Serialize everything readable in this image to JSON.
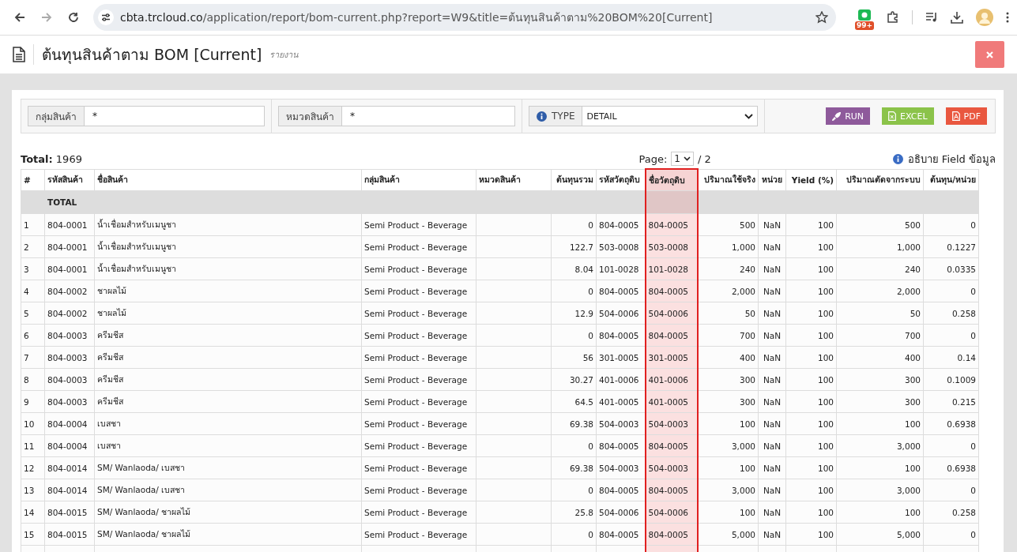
{
  "browser": {
    "url_host": "cbta.trcloud.co",
    "url_path": "/application/report/bom-current.php?report=W9&title=ต้นทุนสินค้าตาม%20BOM%20[Current]",
    "extension_badge": "99+"
  },
  "page_header": {
    "title": "ต้นทุนสินค้าตาม BOM [Current]",
    "subtitle": "รายงาน"
  },
  "filters": [
    {
      "kind": "text",
      "label": "กลุ่มสินค้า",
      "value": "*"
    },
    {
      "kind": "text",
      "label": "หมวดสินค้า",
      "value": "*"
    },
    {
      "kind": "select",
      "label": "TYPE",
      "value": "DETAIL"
    }
  ],
  "actions": [
    {
      "kind": "run",
      "label": "RUN"
    },
    {
      "kind": "excel",
      "label": "EXCEL"
    },
    {
      "kind": "pdf",
      "label": "PDF"
    }
  ],
  "summary": {
    "total": "**Total:** 1969",
    "page_label": "Page:",
    "page": "1",
    "page_count": "/ 2",
    "help_link": "อธิบาย Field ข้อมูล"
  },
  "table": {
    "columns": [
      {
        "label": "#",
        "kind": "text",
        "highlighted": false
      },
      {
        "label": "รหัสสินค้า",
        "kind": "text",
        "highlighted": false
      },
      {
        "label": "ชื่อสินค้า",
        "kind": "text",
        "highlighted": false
      },
      {
        "label": "กลุ่มสินค้า",
        "kind": "text",
        "highlighted": false
      },
      {
        "label": "หมวดสินค้า",
        "kind": "text",
        "highlighted": false
      },
      {
        "label": "ต้นทุนรวม",
        "kind": "number",
        "highlighted": false
      },
      {
        "label": "รหัสวัตถุดิบ",
        "kind": "text",
        "highlighted": false
      },
      {
        "label": "ชื่อวัตถุดิบ",
        "kind": "text",
        "highlighted": true
      },
      {
        "label": "ปริมาณใช้จริง",
        "kind": "number",
        "highlighted": false
      },
      {
        "label": "หน่วย",
        "kind": "unit",
        "highlighted": false
      },
      {
        "label": "Yield (%)",
        "kind": "number",
        "highlighted": false
      },
      {
        "label": "ปริมาณตัดจากระบบ",
        "kind": "number",
        "highlighted": false
      },
      {
        "label": "ต้นทุน/หน่วย",
        "kind": "number",
        "highlighted": false
      }
    ],
    "total_label": "TOTAL",
    "rows": [
      [
        "1",
        "804-0001",
        "น้ำเชื่อมสำหรับเมนูชา",
        "Semi Product - Beverage",
        "",
        "0",
        "804-0005",
        "804-0005",
        "500",
        "NaN",
        "100",
        "500",
        "0"
      ],
      [
        "2",
        "804-0001",
        "น้ำเชื่อมสำหรับเมนูชา",
        "Semi Product - Beverage",
        "",
        "122.7",
        "503-0008",
        "503-0008",
        "1,000",
        "NaN",
        "100",
        "1,000",
        "0.1227"
      ],
      [
        "3",
        "804-0001",
        "น้ำเชื่อมสำหรับเมนูชา",
        "Semi Product - Beverage",
        "",
        "8.04",
        "101-0028",
        "101-0028",
        "240",
        "NaN",
        "100",
        "240",
        "0.0335"
      ],
      [
        "4",
        "804-0002",
        "ชาผลไม้",
        "Semi Product - Beverage",
        "",
        "0",
        "804-0005",
        "804-0005",
        "2,000",
        "NaN",
        "100",
        "2,000",
        "0"
      ],
      [
        "5",
        "804-0002",
        "ชาผลไม้",
        "Semi Product - Beverage",
        "",
        "12.9",
        "504-0006",
        "504-0006",
        "50",
        "NaN",
        "100",
        "50",
        "0.258"
      ],
      [
        "6",
        "804-0003",
        "ครีมชีส",
        "Semi Product - Beverage",
        "",
        "0",
        "804-0005",
        "804-0005",
        "700",
        "NaN",
        "100",
        "700",
        "0"
      ],
      [
        "7",
        "804-0003",
        "ครีมชีส",
        "Semi Product - Beverage",
        "",
        "56",
        "301-0005",
        "301-0005",
        "400",
        "NaN",
        "100",
        "400",
        "0.14"
      ],
      [
        "8",
        "804-0003",
        "ครีมชีส",
        "Semi Product - Beverage",
        "",
        "30.27",
        "401-0006",
        "401-0006",
        "300",
        "NaN",
        "100",
        "300",
        "0.1009"
      ],
      [
        "9",
        "804-0003",
        "ครีมชีส",
        "Semi Product - Beverage",
        "",
        "64.5",
        "401-0005",
        "401-0005",
        "300",
        "NaN",
        "100",
        "300",
        "0.215"
      ],
      [
        "10",
        "804-0004",
        "เบสชา",
        "Semi Product - Beverage",
        "",
        "69.38",
        "504-0003",
        "504-0003",
        "100",
        "NaN",
        "100",
        "100",
        "0.6938"
      ],
      [
        "11",
        "804-0004",
        "เบสชา",
        "Semi Product - Beverage",
        "",
        "0",
        "804-0005",
        "804-0005",
        "3,000",
        "NaN",
        "100",
        "3,000",
        "0"
      ],
      [
        "12",
        "804-0014",
        "SM/ Wanlaoda/ เบสชา",
        "Semi Product - Beverage",
        "",
        "69.38",
        "504-0003",
        "504-0003",
        "100",
        "NaN",
        "100",
        "100",
        "0.6938"
      ],
      [
        "13",
        "804-0014",
        "SM/ Wanlaoda/ เบสชา",
        "Semi Product - Beverage",
        "",
        "0",
        "804-0005",
        "804-0005",
        "3,000",
        "NaN",
        "100",
        "3,000",
        "0"
      ],
      [
        "14",
        "804-0015",
        "SM/ Wanlaoda/ ชาผลไม้",
        "Semi Product - Beverage",
        "",
        "25.8",
        "504-0006",
        "504-0006",
        "100",
        "NaN",
        "100",
        "100",
        "0.258"
      ],
      [
        "15",
        "804-0015",
        "SM/ Wanlaoda/ ชาผลไม้",
        "Semi Product - Beverage",
        "",
        "0",
        "804-0005",
        "804-0005",
        "5,000",
        "NaN",
        "100",
        "5,000",
        "0"
      ]
    ]
  }
}
